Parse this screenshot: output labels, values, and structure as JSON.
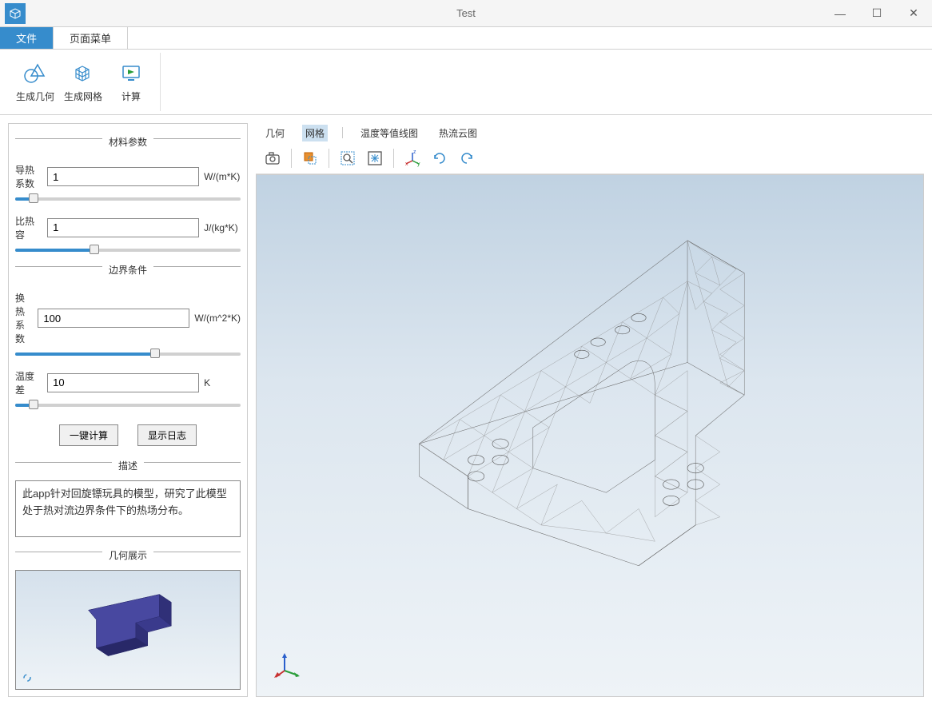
{
  "window": {
    "title": "Test",
    "minimize": "—",
    "maximize": "☐",
    "close": "✕"
  },
  "tabs": {
    "file": "文件",
    "page_menu": "页面菜单"
  },
  "ribbon": {
    "gen_geometry": "生成几何",
    "gen_mesh": "生成网格",
    "compute": "计算"
  },
  "panels": {
    "material_params": "材料参数",
    "boundary_conditions": "边界条件",
    "description": "描述",
    "geometry_display": "几何展示"
  },
  "params": {
    "thermal_conductivity": {
      "label": "导热系数",
      "value": "1",
      "unit": "W/(m*K)",
      "slider_pct": 8
    },
    "specific_heat": {
      "label": "比热容",
      "value": "1",
      "unit": "J/(kg*K)",
      "slider_pct": 35
    },
    "heat_transfer_coeff": {
      "label": "换热系数",
      "value": "100",
      "unit": "W/(m^2*K)",
      "slider_pct": 62
    },
    "temperature_diff": {
      "label": "温度差",
      "value": "10",
      "unit": "K",
      "slider_pct": 8
    }
  },
  "actions": {
    "one_click_compute": "一键计算",
    "show_log": "显示日志"
  },
  "description_text": "此app针对回旋镖玩具的模型，研究了此模型处于热对流边界条件下的热场分布。",
  "view_tabs": {
    "geometry": "几何",
    "mesh": "网格",
    "temp_contour": "温度等值线图",
    "heat_flow": "热流云图"
  },
  "toolbar_icons": {
    "screenshot": "screenshot-icon",
    "select": "select-box-icon",
    "zoom_window": "zoom-window-icon",
    "zoom_extents": "zoom-extents-icon",
    "axis_view": "axis-view-icon",
    "rotate_left": "rotate-left-icon",
    "rotate_right": "rotate-right-icon"
  },
  "colors": {
    "accent": "#368ccc",
    "axis_x": "#c83232",
    "axis_y": "#2a9d3a",
    "axis_z": "#2a5fcc"
  }
}
